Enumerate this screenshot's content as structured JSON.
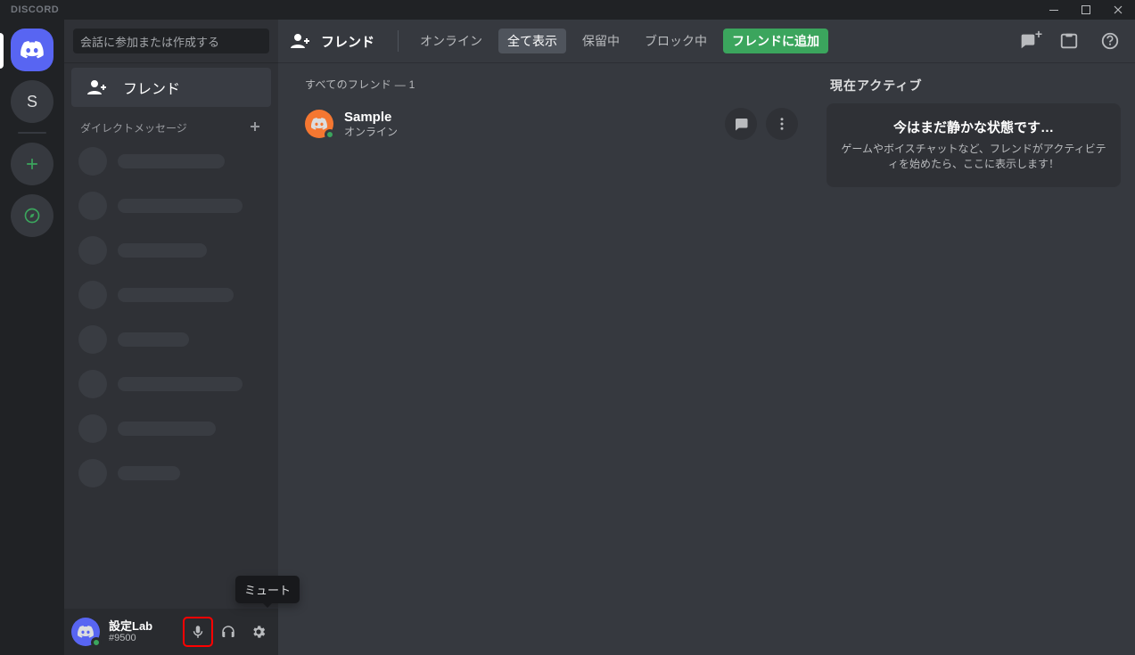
{
  "titlebar": {
    "logo": "DISCORD"
  },
  "servers": {
    "letter": "S"
  },
  "sidebar": {
    "search_placeholder": "会話に参加または作成する",
    "friends_label": "フレンド",
    "dm_header": "ダイレクトメッセージ"
  },
  "user_panel": {
    "name": "設定Lab",
    "discriminator": "#9500",
    "tooltip": "ミュート"
  },
  "topbar": {
    "title": "フレンド",
    "tabs": {
      "online": "オンライン",
      "all": "全て表示",
      "pending": "保留中",
      "blocked": "ブロック中",
      "add": "フレンドに追加"
    }
  },
  "friends_list": {
    "header": "すべてのフレンド — 1",
    "items": [
      {
        "name": "Sample",
        "status": "オンライン"
      }
    ]
  },
  "activity": {
    "header": "現在アクティブ",
    "title": "今はまだ静かな状態です…",
    "subtitle": "ゲームやボイスチャットなど、フレンドがアクティビティを始めたら、ここに表示します！"
  }
}
